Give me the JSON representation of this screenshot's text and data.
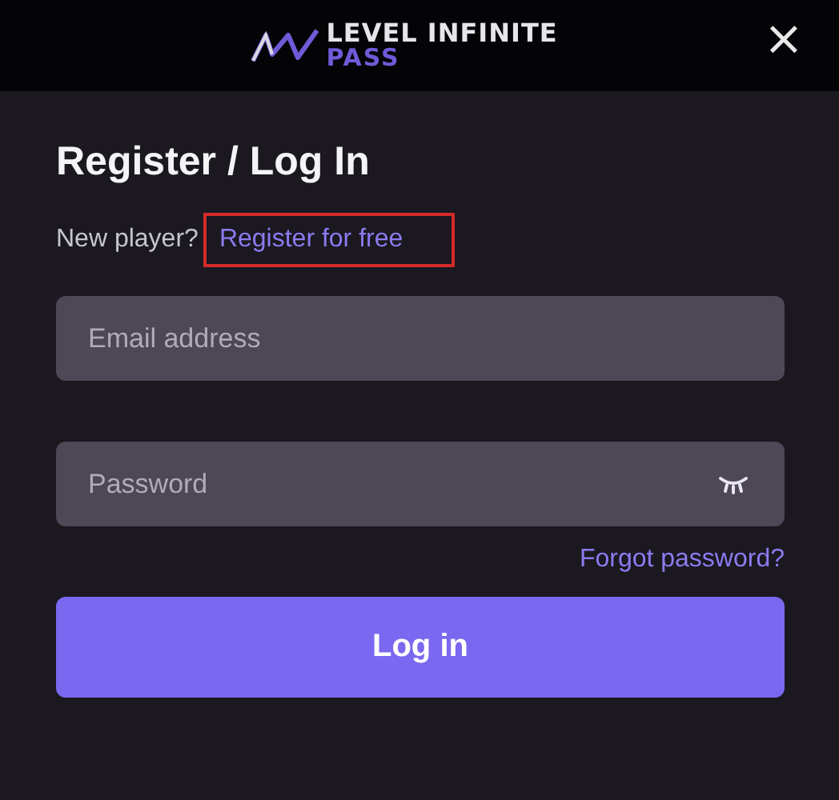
{
  "header": {
    "logo_top": "LEVEL INFINITE",
    "logo_bottom": "PASS",
    "close": "×"
  },
  "title": "Register / Log In",
  "prompt": {
    "text": "New player?",
    "link": "Register for free",
    "highlighted": true
  },
  "fields": [
    {
      "placeholder": "Email address",
      "kind": "text"
    },
    {
      "placeholder": "Password",
      "kind": "password"
    }
  ],
  "forgot": "Forgot password?",
  "button": "Log in"
}
